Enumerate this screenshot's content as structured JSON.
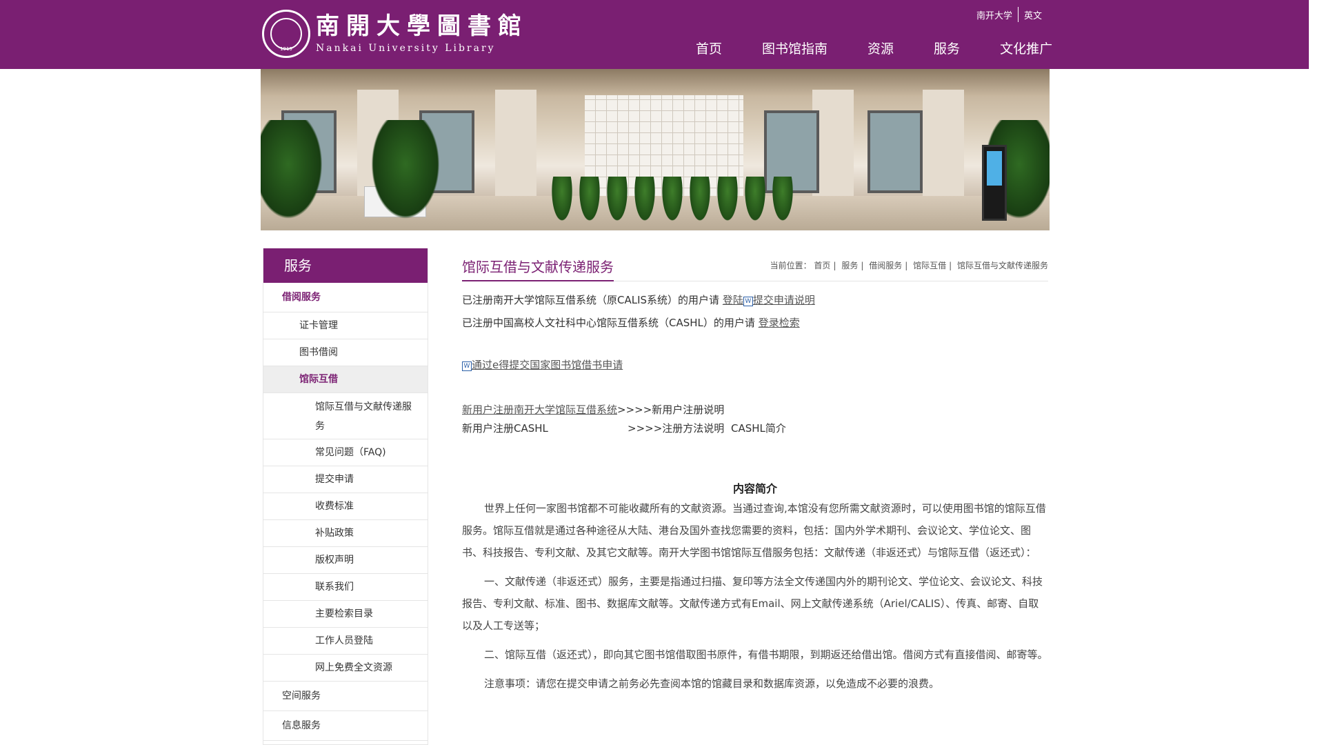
{
  "header": {
    "logo_cn": "南開大學圖書館",
    "logo_en": "Nankai University Library",
    "seal_year": "1919",
    "top_links": [
      "南开大学",
      "英文"
    ],
    "nav": [
      "首页",
      "图书馆指南",
      "资源",
      "服务",
      "文化推广"
    ]
  },
  "sidebar": {
    "title": "服务",
    "items": [
      {
        "label": "借阅服务"
      },
      {
        "label": "证卡管理"
      },
      {
        "label": "图书借阅"
      },
      {
        "label": "馆际互借"
      },
      {
        "label": "馆际互借与文献传递服务"
      },
      {
        "label": "常见问题（FAQ)"
      },
      {
        "label": "提交申请"
      },
      {
        "label": "收费标准"
      },
      {
        "label": "补贴政策"
      },
      {
        "label": "版权声明"
      },
      {
        "label": "联系我们"
      },
      {
        "label": "主要检索目录"
      },
      {
        "label": "工作人员登陆"
      },
      {
        "label": "网上免费全文资源"
      },
      {
        "label": "空间服务"
      },
      {
        "label": "信息服务"
      }
    ]
  },
  "content": {
    "title": "馆际互借与文献传递服务",
    "breadcrumb_prefix": "当前位置：",
    "breadcrumb": [
      "首页",
      "服务",
      "借阅服务",
      "馆际互借",
      "馆际互借与文献传递服务"
    ],
    "line1_text": "已注册南开大学馆际互借系统（原CALIS系统）的用户请",
    "line1_link1": "登陆",
    "line1_link2": "提交申请说明",
    "line2_text": "已注册中国高校人文社科中心馆际互借系统（CASHL）的用户请",
    "line2_link": "登录检索",
    "line3_link": "通过e得提交国家图书馆借书申请",
    "reg1_link": "新用户注册南开大学馆际互借系统",
    "reg1_text": ">>>>新用户注册说明",
    "reg2_label": "新用户注册CASHL",
    "reg2_text": ">>>>注册方法说明",
    "reg2_extra": "CASHL简介",
    "intro_title": "内容简介",
    "paragraphs": [
      "世界上任何一家图书馆都不可能收藏所有的文献资源。当通过查询,本馆没有您所需文献资源时，可以使用图书馆的馆际互借服务。馆际互借就是通过各种途径从大陆、港台及国外查找您需要的资料，包括：国内外学术期刊、会议论文、学位论文、图书、科技报告、专利文献、及其它文献等。南开大学图书馆馆际互借服务包括：文献传递（非返还式）与馆际互借（返还式）：",
      "一、文献传递（非返还式）服务，主要是指通过扫描、复印等方法全文传递国内外的期刊论文、学位论文、会议论文、科技报告、专利文献、标准、图书、数据库文献等。文献传递方式有Email、网上文献传递系统（Ariel/CALIS）、传真、邮寄、自取以及人工专送等；",
      "二、馆际互借（返还式），即向其它图书馆借取图书原件，有借书期限，到期返还给借出馆。借阅方式有直接借阅、邮寄等。",
      "注意事项：请您在提交申请之前务必先查阅本馆的馆藏目录和数据库资源，以免造成不必要的浪费。"
    ]
  }
}
